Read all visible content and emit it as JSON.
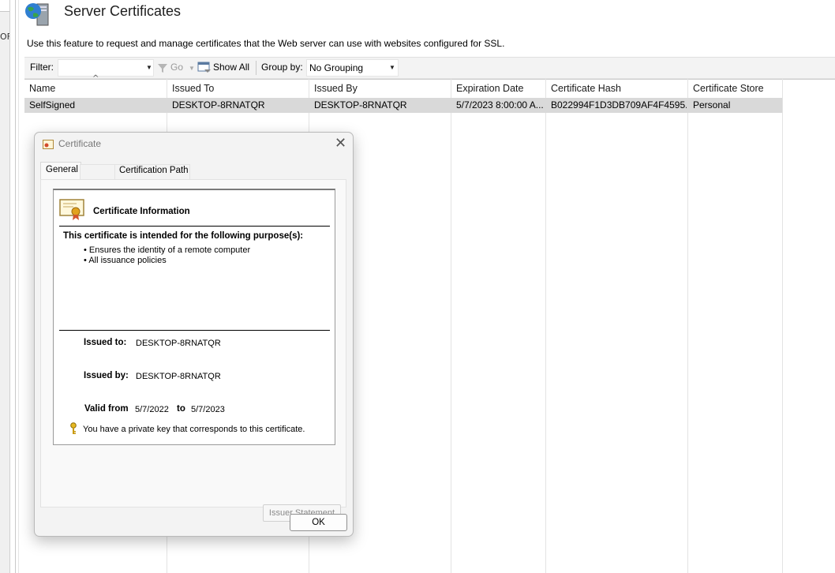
{
  "left_panel": {
    "fragment": "OF"
  },
  "header": {
    "title": "Server Certificates",
    "description": "Use this feature to request and manage certificates that the Web server can use with websites configured for SSL."
  },
  "toolbar": {
    "filter_label": "Filter:",
    "filter_value": "",
    "go_label": "Go",
    "show_all_label": "Show All",
    "group_by_label": "Group by:",
    "group_by_value": "No Grouping"
  },
  "table": {
    "columns": [
      "Name",
      "Issued To",
      "Issued By",
      "Expiration Date",
      "Certificate Hash",
      "Certificate Store"
    ],
    "rows": [
      {
        "name": "SelfSigned",
        "issued_to": "DESKTOP-8RNATQR",
        "issued_by": "DESKTOP-8RNATQR",
        "expiration": "5/7/2023 8:00:00 A...",
        "hash": "B022994F1D3DB709AF4F4595...",
        "store": "Personal"
      }
    ]
  },
  "dialog": {
    "title": "Certificate",
    "close_glyph": "✕",
    "tabs": [
      "General",
      "",
      "Certification Path"
    ],
    "info_heading": "Certificate Information",
    "purpose_heading": "This certificate is intended for the following purpose(s):",
    "purposes": [
      "Ensures the identity of a remote computer",
      "All issuance policies"
    ],
    "issued_to_label": "Issued to:",
    "issued_to_value": "DESKTOP-8RNATQR",
    "issued_by_label": "Issued by:",
    "issued_by_value": "DESKTOP-8RNATQR",
    "valid_from_label": "Valid from",
    "valid_from_value": "5/7/2022",
    "valid_to_label": "to",
    "valid_to_value": "5/7/2023",
    "private_key_note": "You have a private key that corresponds to this certificate.",
    "issuer_statement_label": "Issuer Statement",
    "ok_label": "OK"
  },
  "colors": {
    "selected_row": "#d9d9d9",
    "toolbar_bg": "#f3f3f3",
    "dialog_bg": "#f3f3f3",
    "disabled_text": "#8a8a8a"
  },
  "icons": [
    "server-certificates-icon",
    "filter-funnel-icon",
    "show-all-icon",
    "certificate-title-icon",
    "certificate-ribbon-icon",
    "key-icon",
    "close-icon"
  ]
}
